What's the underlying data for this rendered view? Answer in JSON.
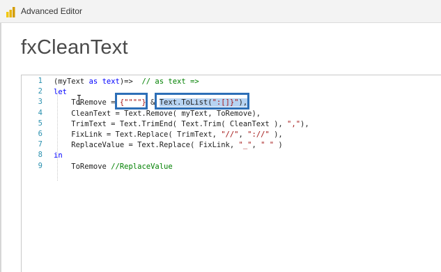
{
  "window": {
    "title": "Advanced Editor",
    "accent_color": "#f2c811"
  },
  "query": {
    "name": "fxCleanText"
  },
  "editor": {
    "line_numbers": [
      "1",
      "2",
      "3",
      "4",
      "5",
      "6",
      "7",
      "8",
      "9"
    ],
    "lines": [
      [
        {
          "t": "(myText ",
          "c": ""
        },
        {
          "t": "as",
          "c": "kw"
        },
        {
          "t": " ",
          "c": ""
        },
        {
          "t": "text",
          "c": "kw"
        },
        {
          "t": ")=>  ",
          "c": ""
        },
        {
          "t": "// as text =>",
          "c": "cm"
        }
      ],
      [
        {
          "t": "let",
          "c": "kw"
        }
      ],
      [
        {
          "t": "    ToRemove = ",
          "c": ""
        },
        {
          "t": "{\"\"\"\"}",
          "c": "st"
        },
        {
          "t": " & ",
          "c": ""
        },
        {
          "t": "Text.ToList(",
          "c": "hl"
        },
        {
          "t": "\":[]}\"",
          "c": "hl st"
        },
        {
          "t": "),",
          "c": "hl"
        }
      ],
      [
        {
          "t": "    CleanText = Text.Remove( myText, ToRemove),",
          "c": ""
        }
      ],
      [
        {
          "t": "    TrimText = Text.TrimEnd( Text.Trim( CleanText ), ",
          "c": ""
        },
        {
          "t": "\",\"",
          "c": "st"
        },
        {
          "t": "),",
          "c": ""
        }
      ],
      [
        {
          "t": "    FixLink = Text.Replace( TrimText, ",
          "c": ""
        },
        {
          "t": "\"//\"",
          "c": "st"
        },
        {
          "t": ", ",
          "c": ""
        },
        {
          "t": "\"://\"",
          "c": "st"
        },
        {
          "t": " ),",
          "c": ""
        }
      ],
      [
        {
          "t": "    ReplaceValue = Text.Replace( FixLink, ",
          "c": ""
        },
        {
          "t": "\"_\"",
          "c": "st"
        },
        {
          "t": ", ",
          "c": ""
        },
        {
          "t": "\" \"",
          "c": "st"
        },
        {
          "t": " )",
          "c": ""
        }
      ],
      [
        {
          "t": "in",
          "c": "kw"
        }
      ],
      [
        {
          "t": "    ToRemove ",
          "c": ""
        },
        {
          "t": "//ReplaceValue",
          "c": "cm"
        }
      ]
    ]
  }
}
